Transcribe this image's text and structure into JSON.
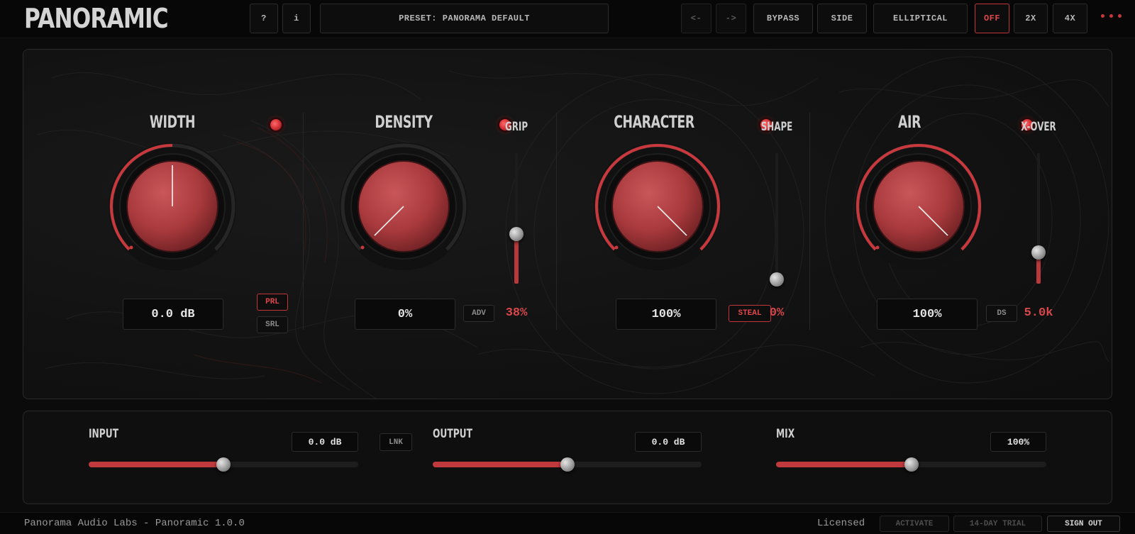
{
  "header": {
    "logo": "PANORAMIC",
    "help_label": "?",
    "info_label": "i",
    "preset_label": "PRESET: PANORAMA DEFAULT",
    "prev_label": "<-",
    "next_label": "->",
    "bypass_label": "BYPASS",
    "side_label": "SIDE",
    "mode_label": "ELLIPTICAL",
    "off_label": "OFF",
    "x2_label": "2X",
    "x4_label": "4X",
    "more_icon": "more-dots-icon"
  },
  "modules": {
    "width": {
      "title": "WIDTH",
      "value": "0.0 dB",
      "prl": "PRL",
      "srl": "SRL",
      "knob_fraction": 0.5
    },
    "density": {
      "title": "DENSITY",
      "value": "0%",
      "adv": "ADV",
      "knob_fraction": 0.0,
      "grip": {
        "title": "GRIP",
        "value": "38%",
        "fraction": 0.38
      }
    },
    "character": {
      "title": "CHARACTER",
      "value": "100%",
      "steal": "STEAL",
      "knob_fraction": 1.0,
      "shape": {
        "title": "SHAPE",
        "value": "0%",
        "fraction": 0.0
      }
    },
    "air": {
      "title": "AIR",
      "value": "100%",
      "ds": "DS",
      "knob_fraction": 1.0,
      "xover": {
        "title": "X-OVER",
        "value": "5.0k",
        "fraction": 0.24
      }
    }
  },
  "io": {
    "input": {
      "label": "INPUT",
      "value": "0.0 dB",
      "fraction": 0.5
    },
    "link_label": "LNK",
    "output": {
      "label": "OUTPUT",
      "value": "0.0 dB",
      "fraction": 0.5
    },
    "mix": {
      "label": "MIX",
      "value": "100%",
      "fraction": 0.5
    }
  },
  "footer": {
    "text": "Panorama Audio Labs - Panoramic 1.0.0",
    "licensed": "Licensed",
    "activate": "ACTIVATE",
    "trial": "14-DAY TRIAL",
    "signout": "SIGN OUT"
  },
  "colors": {
    "accent": "#c9383c",
    "knob": "#b03a3e",
    "background": "#0b0b0b"
  }
}
